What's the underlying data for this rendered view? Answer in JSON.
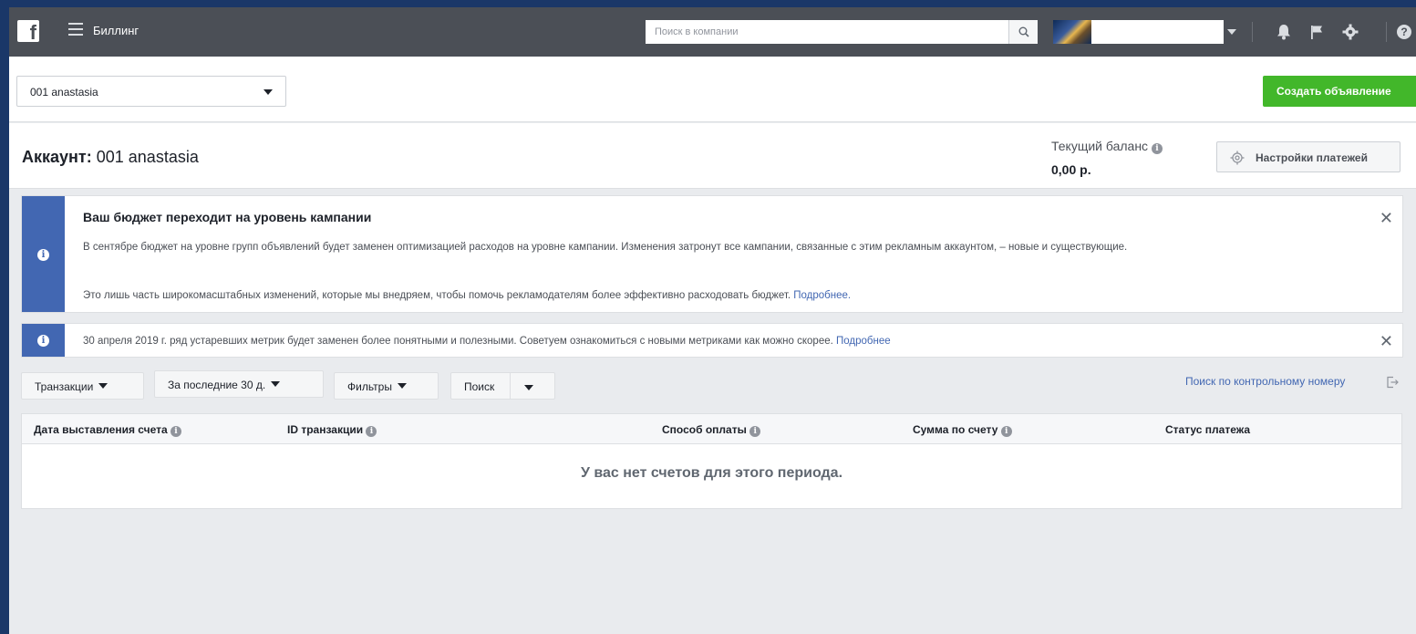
{
  "topbar": {
    "title": "Биллинг",
    "search_placeholder": "Поиск в компании",
    "icons": [
      "facebook-logo",
      "menu-icon",
      "search-icon",
      "bell-icon",
      "flag-icon",
      "gear-icon",
      "help-icon"
    ]
  },
  "subheader": {
    "account_selector_value": "001 anastasia",
    "create_ad_label": "Создать объявление"
  },
  "account": {
    "heading_prefix": "Аккаунт:",
    "heading_name": "001 anastasia",
    "balance_label": "Текущий баланс",
    "balance_value": "0,00 р.",
    "payment_settings_label": "Настройки платежей"
  },
  "notices": [
    {
      "title": "Ваш бюджет переходит на уровень кампании",
      "paragraph1": "В сентябре бюджет на уровне групп объявлений будет заменен оптимизацией расходов на уровне кампании. Изменения затронут все кампании, связанные с этим рекламным аккаунтом, – новые и существующие.",
      "paragraph2": "Это лишь часть широкомасштабных изменений, которые мы внедряем, чтобы помочь рекламодателям более эффективно расходовать бюджет.",
      "link": "Подробнее."
    },
    {
      "text": "30 апреля 2019 г. ряд устаревших метрик будет заменен более понятными и полезными. Советуем ознакомиться с новыми метриками как можно скорее.",
      "link": "Подробнее"
    }
  ],
  "toolbar": {
    "transactions": "Транзакции",
    "period": "За последние 30 д.",
    "filters": "Фильтры",
    "search": "Поиск",
    "search_by_control_number": "Поиск по контрольному номеру"
  },
  "table": {
    "columns": [
      "Дата выставления счета",
      "ID транзакции",
      "Способ оплаты",
      "Сумма по счету",
      "Статус платежа"
    ],
    "empty_message": "У вас нет счетов для этого периода."
  },
  "colors": {
    "topbar": "#4b4f56",
    "accent_blue": "#4267b2",
    "create_green": "#42b72a",
    "background": "#e9ebee"
  }
}
